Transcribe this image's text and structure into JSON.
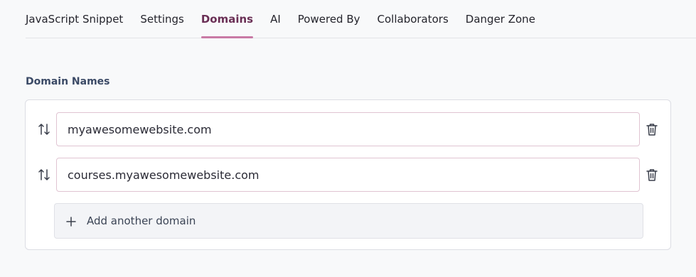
{
  "tabs": [
    {
      "label": "JavaScript Snippet",
      "active": false
    },
    {
      "label": "Settings",
      "active": false
    },
    {
      "label": "Domains",
      "active": true
    },
    {
      "label": "AI",
      "active": false
    },
    {
      "label": "Powered By",
      "active": false
    },
    {
      "label": "Collaborators",
      "active": false
    },
    {
      "label": "Danger Zone",
      "active": false
    }
  ],
  "domains": {
    "section_label": "Domain Names",
    "entries": [
      {
        "value": "myawesomewebsite.com"
      },
      {
        "value": "courses.myawesomewebsite.com"
      }
    ],
    "add_label": "Add another domain"
  },
  "icons": {
    "drag": "reorder-arrows-icon",
    "delete": "trash-icon",
    "add": "plus-icon"
  },
  "colors": {
    "accent": "#c97aa5",
    "active_tab_text": "#6a2f55"
  }
}
